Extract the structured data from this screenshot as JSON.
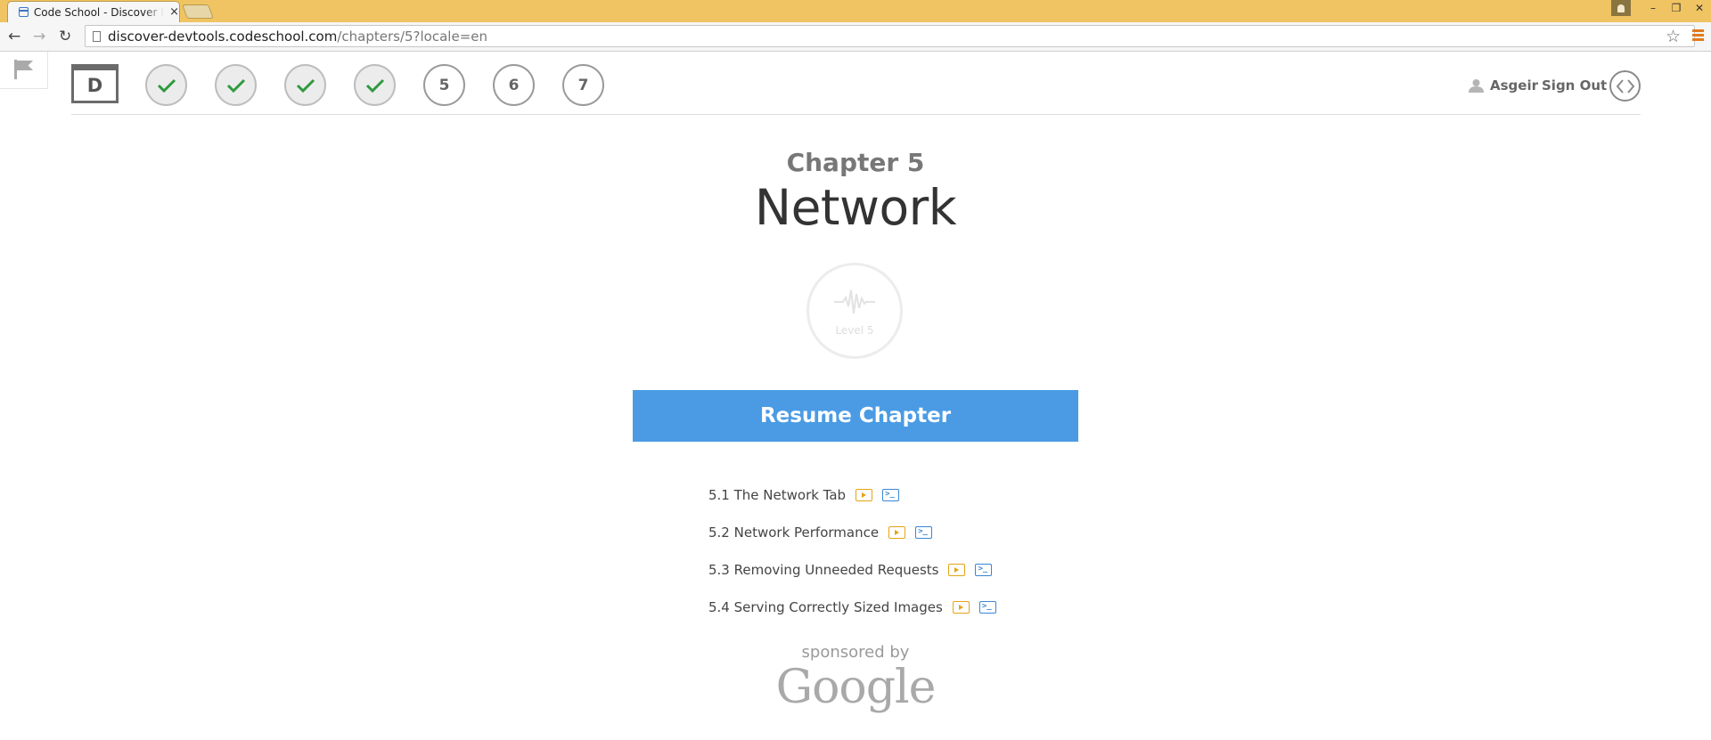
{
  "browser": {
    "tab_title": "Code School - Discover DevTools",
    "tab_close": "×",
    "url_domain": "discover-devtools.codeschool.com",
    "url_path": "/chapters/5?locale=en",
    "back": "←",
    "forward": "→",
    "reload": "↻",
    "star": "☆",
    "minimize": "–",
    "restore": "❐",
    "close": "✕"
  },
  "header": {
    "logo_letter": "D",
    "steps": [
      {
        "status": "done",
        "label": ""
      },
      {
        "status": "done",
        "label": ""
      },
      {
        "status": "done",
        "label": ""
      },
      {
        "status": "done",
        "label": ""
      },
      {
        "status": "todo",
        "label": "5"
      },
      {
        "status": "todo",
        "label": "6"
      },
      {
        "status": "todo",
        "label": "7"
      }
    ],
    "user_name": "Asgeir",
    "sign_out": "Sign Out"
  },
  "chapter": {
    "label": "Chapter 5",
    "title": "Network",
    "badge_text": "Level 5",
    "resume_label": "Resume Chapter",
    "lessons": [
      {
        "label": "5.1 The Network Tab"
      },
      {
        "label": "5.2 Network Performance"
      },
      {
        "label": "5.3 Removing Unneeded Requests"
      },
      {
        "label": "5.4 Serving Correctly Sized Images"
      }
    ]
  },
  "sponsor": {
    "label": "sponsored by",
    "name": "Google"
  },
  "colors": {
    "titlebar": "#f0c462",
    "accent": "#4a9be4",
    "check": "#2e9a3e",
    "video_icon": "#e6a317",
    "console_icon": "#3a86d6"
  }
}
